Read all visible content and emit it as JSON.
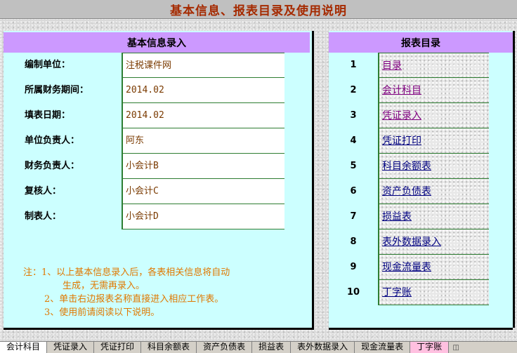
{
  "title": "基本信息、报表目录及使用说明",
  "basic_info": {
    "header": "基本信息录入",
    "fields": [
      {
        "label": "编制单位：",
        "value": "注税课件网"
      },
      {
        "label": "所属财务期间：",
        "value": "2014.02"
      },
      {
        "label": "填表日期：",
        "value": "2014.02"
      },
      {
        "label": "单位负责人：",
        "value": "阿东"
      },
      {
        "label": "财务负责人：",
        "value": "小会计B"
      },
      {
        "label": "复核人：",
        "value": "小会计C"
      },
      {
        "label": "制表人：",
        "value": "小会计D"
      }
    ],
    "notes": {
      "line1": "注：1、以上基本信息录入后，各表相关信息将自动",
      "line2": "生成，无需再录入。",
      "line3": "2、单击右边报表名称直接进入相应工作表。",
      "line4": "3、使用前请阅读以下说明。"
    }
  },
  "directory": {
    "header": "报表目录",
    "items": [
      {
        "num": "1",
        "name": "目录"
      },
      {
        "num": "2",
        "name": "会计科目"
      },
      {
        "num": "3",
        "name": "凭证录入"
      },
      {
        "num": "4",
        "name": "凭证打印"
      },
      {
        "num": "5",
        "name": "科目余额表"
      },
      {
        "num": "6",
        "name": "资产负债表"
      },
      {
        "num": "7",
        "name": "损益表"
      },
      {
        "num": "8",
        "name": "表外数据录入"
      },
      {
        "num": "9",
        "name": "现金流量表"
      },
      {
        "num": "10",
        "name": "丁字账"
      }
    ]
  },
  "sheet_tabs": [
    "会计科目",
    "凭证录入",
    "凭证打印",
    "科目余额表",
    "资产负债表",
    "损益表",
    "表外数据录入",
    "现金流量表",
    "丁字账"
  ],
  "colors": {
    "title": "#a52a00",
    "panel_bg": "#ccffff",
    "panel_header": "#cc99ff",
    "link": "#800080",
    "note": "#e07800"
  }
}
